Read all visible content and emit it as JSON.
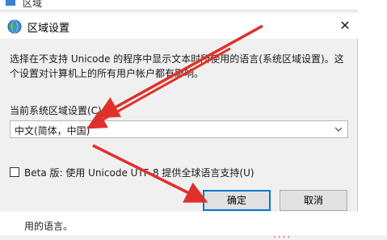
{
  "background_window": {
    "title": "区域",
    "bottom_text": "用的语言。",
    "watermark": "...."
  },
  "dialog": {
    "title": "区域设置",
    "close_glyph": "✕",
    "description": "选择在不支持 Unicode 的程序中显示文本时所使用的语言(系统区域设置)。这个设置对计算机上的所有用户帐户都有影响。",
    "locale_label": "当前系统区域设置(C):",
    "locale_selected": "中文(简体，中国)",
    "beta_label": "Beta 版: 使用 Unicode UTF-8 提供全球语言支持(U)",
    "beta_checked": false,
    "ok_label": "确定",
    "cancel_label": "取消"
  },
  "colors": {
    "arrow": "#e0302a",
    "accent": "#0078d7"
  },
  "icons": {
    "dialog": "globe-icon",
    "select": "chevron-down-icon",
    "close": "close-icon"
  }
}
